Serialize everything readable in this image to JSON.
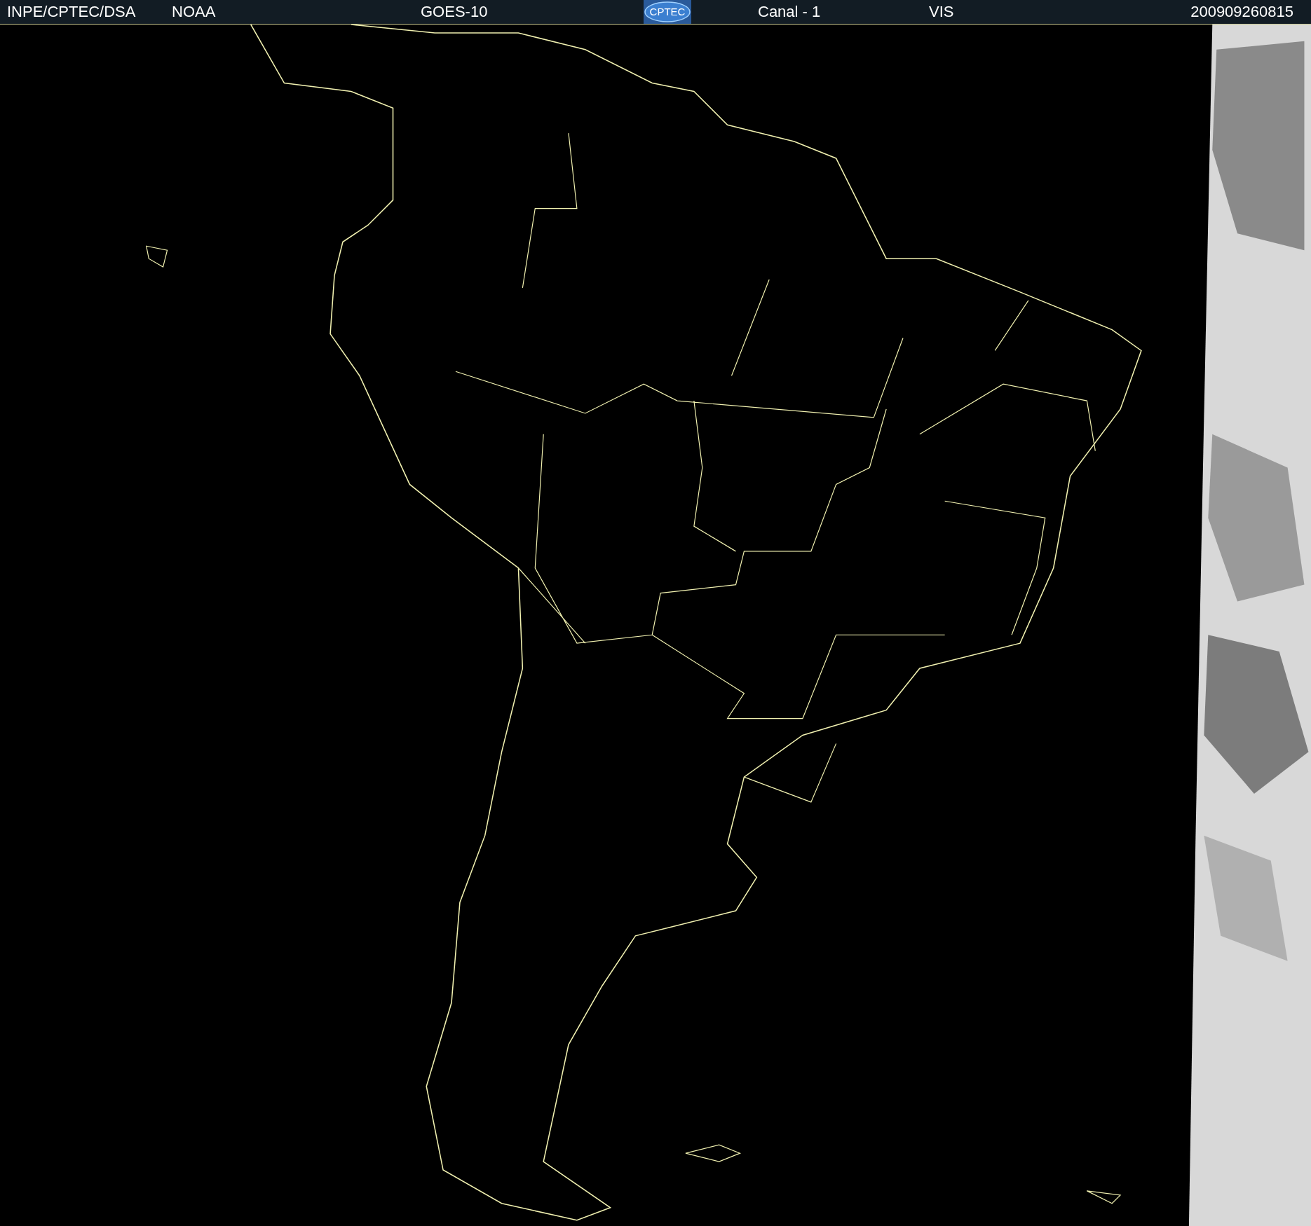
{
  "header": {
    "source": "INPE/CPTEC/DSA",
    "agency": "NOAA",
    "satellite": "GOES-10",
    "logo": "CPTEC",
    "channel": "Canal - 1",
    "band": "VIS",
    "timestamp": "200909260815"
  }
}
